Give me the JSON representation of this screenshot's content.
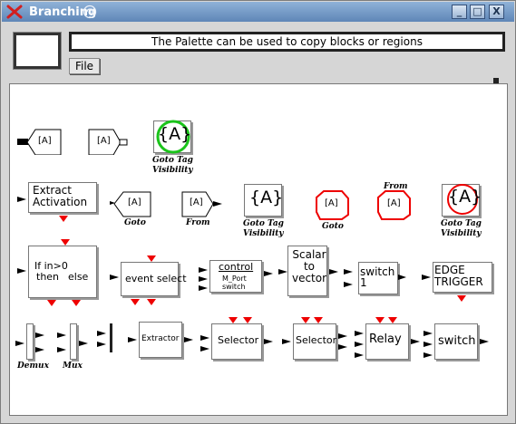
{
  "window": {
    "title": "Branching",
    "buttons": {
      "minimize": "_",
      "maximize": "□",
      "close": "X"
    }
  },
  "toolbar": {
    "message": "The Palette can be used to copy blocks or regions",
    "file_label": "File"
  },
  "blocks": {
    "goto_left_text": "[A]",
    "from_right_text": "[A]",
    "visibility_green_text": "{A}",
    "visibility_green_label": "Goto Tag Visibility",
    "extract_text": "Extract Activation",
    "goto_text": "[A]",
    "goto_label": "Goto",
    "from_text": "[A]",
    "from_label": "From",
    "visibility_text": "{A}",
    "visibility_label": "Goto Tag Visibility",
    "goto_red_text": "[A]",
    "goto_red_label": "Goto",
    "from_red_text": "[A]",
    "from_red_label": "From",
    "visibility_red_text": "{A}",
    "visibility_red_label": "Goto Tag Visibility",
    "ifthen_line1": "If in>0",
    "ifthen_then": "then",
    "ifthen_else": "else",
    "event_select_text": "event select",
    "mport_title": "control",
    "mport_sub1": "M_Port",
    "mport_sub2": "switch",
    "scalar_text": "Scalar to vector",
    "switch1_text": "switch 1",
    "edge_text": "EDGE TRIGGER",
    "demux_label": "Demux",
    "mux_label": "Mux",
    "extractor_text": "Extractor",
    "selector1_text": "Selector",
    "selector2_text": "Selector",
    "relay_text": "Relay",
    "switch_text": "switch"
  }
}
